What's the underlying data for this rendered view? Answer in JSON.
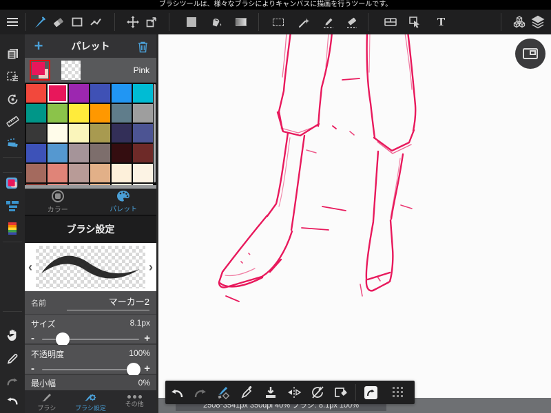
{
  "notification": "ブラシツールは、様々なブラシによりキャンバスに描画を行うツールです。",
  "toolbar": {
    "text_tool": "T"
  },
  "palette": {
    "title": "パレット",
    "add_label": "+",
    "current_color_name": "Pink",
    "selected": "#e8175b",
    "swatches": [
      "#f2483c",
      "#e8175b",
      "#9c27b0",
      "#3f51b5",
      "#2196f3",
      "#00bcd4",
      "#009688",
      "#8bc34a",
      "#ffeb3b",
      "#ff9800",
      "#607d8b",
      "#9e9e9e",
      "#383838",
      "#fffcea",
      "#faf5bb",
      "#a89a50",
      "#332f58",
      "#4c5493",
      "#3d52b8",
      "#5598d0",
      "#a59499",
      "#7d6e6c",
      "#340d10",
      "#6e2a28",
      "#a46a5e",
      "#e08478",
      "#b89b97",
      "#e2b088",
      "#fdf0da",
      "#fcf3e4"
    ],
    "partial_swatches": [
      "#8c3a32",
      "#e48a80",
      "#c2a49e",
      "#e8b88e",
      "#fdf0da",
      "#fdf4e6"
    ]
  },
  "panel_tabs": {
    "color": "カラー",
    "palette": "パレット"
  },
  "brush": {
    "header": "ブラシ設定",
    "name_label": "名前",
    "name_value": "マーカー2",
    "size_label": "サイズ",
    "size_value": "8.1px",
    "size_percent": 21,
    "opacity_label": "不透明度",
    "opacity_value": "100%",
    "opacity_percent": 94,
    "minwidth_label": "最小幅",
    "minwidth_value": "0%",
    "minus": "-",
    "plus": "+",
    "prev": "‹",
    "next": "›"
  },
  "bottom_tabs": {
    "brush": "ブラシ",
    "brush_settings": "ブラシ設定",
    "other": "その他"
  },
  "statusbar": {
    "text": "2508*3541px 350dpi 40% ブラシ: 8.1px 100%"
  },
  "colors": {
    "accent": "#4a9fd6",
    "selected_pink": "#e8175b",
    "pink_shadow": "#f4cfc6",
    "sketch": "#e8195c"
  }
}
